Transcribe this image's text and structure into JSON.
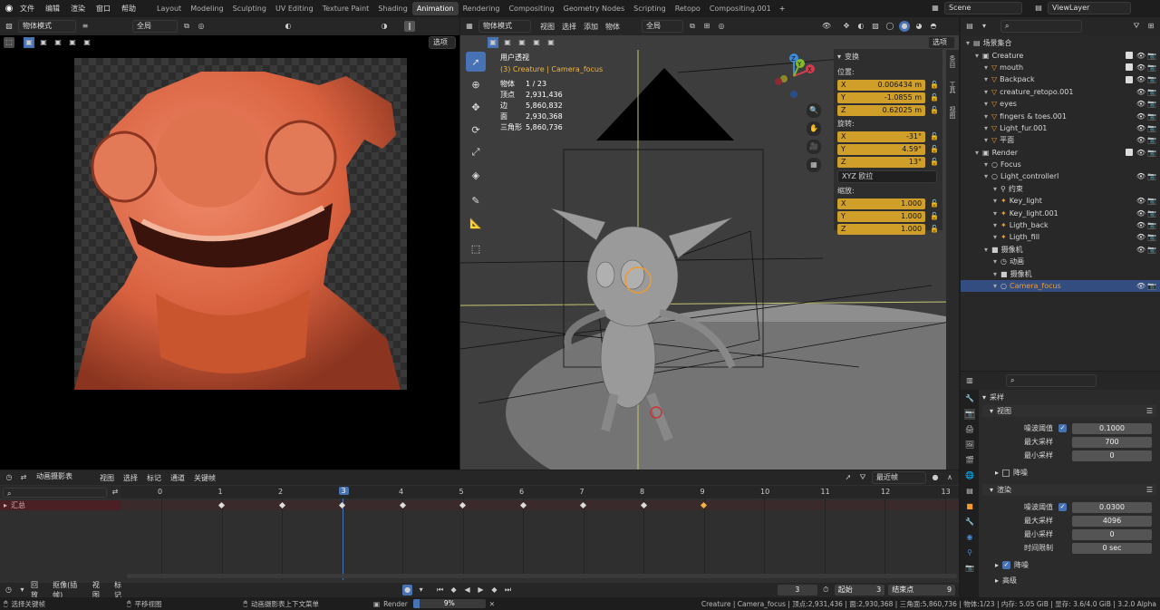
{
  "topbar": {
    "menu": [
      "文件",
      "编辑",
      "渲染",
      "窗口",
      "帮助"
    ],
    "tabs": [
      "Layout",
      "Modeling",
      "Sculpting",
      "UV Editing",
      "Texture Paint",
      "Shading",
      "Animation",
      "Rendering",
      "Compositing",
      "Geometry Nodes",
      "Scripting",
      "Retopo",
      "Compositing.001"
    ],
    "active_tab": "Animation",
    "add_tab": "+",
    "scene": "Scene",
    "view_layer": "ViewLayer"
  },
  "left_header": {
    "mode": "物体模式",
    "view": "全局",
    "options": "选项"
  },
  "viewport": {
    "mode": "物体模式",
    "menus": [
      "视图",
      "选择",
      "添加",
      "物体"
    ],
    "transform": "全局",
    "options": "选项",
    "view_name": "用户透视",
    "collection_label": "(3) Creature | Camera_focus",
    "stats": [
      {
        "k": "物体",
        "v": "1 / 23"
      },
      {
        "k": "顶点",
        "v": "2,931,436"
      },
      {
        "k": "边",
        "v": "5,860,832"
      },
      {
        "k": "面",
        "v": "2,930,368"
      },
      {
        "k": "三角形",
        "v": "5,860,736"
      }
    ],
    "gizmo": {
      "x": "X",
      "y": "Y",
      "z": "Z"
    }
  },
  "npanel": {
    "title": "变换",
    "location_label": "位置:",
    "location": [
      {
        "a": "X",
        "v": "0.006434 m"
      },
      {
        "a": "Y",
        "v": "-1.0855 m"
      },
      {
        "a": "Z",
        "v": "0.62025 m"
      }
    ],
    "rotation_label": "旋转:",
    "rotation": [
      {
        "a": "X",
        "v": "-31°"
      },
      {
        "a": "Y",
        "v": "4.59°"
      },
      {
        "a": "Z",
        "v": "13°"
      }
    ],
    "rotation_mode": "XYZ 欧拉",
    "scale_label": "缩放:",
    "scale": [
      {
        "a": "X",
        "v": "1.000"
      },
      {
        "a": "Y",
        "v": "1.000"
      },
      {
        "a": "Z",
        "v": "1.000"
      }
    ],
    "side_tabs": [
      "条目",
      "工具",
      "视图"
    ]
  },
  "outliner": {
    "rows": [
      {
        "name": "场景集合",
        "indent": 0,
        "icon": "▤",
        "cb": false,
        "eye": false,
        "cam": false
      },
      {
        "name": "Creature",
        "indent": 1,
        "icon": "▣",
        "cb": true,
        "eye": true,
        "cam": true
      },
      {
        "name": "mouth",
        "indent": 2,
        "icon": "▽",
        "cb": true,
        "eye": true,
        "cam": true
      },
      {
        "name": "Backpack",
        "indent": 2,
        "icon": "▽",
        "cb": true,
        "eye": true,
        "cam": true
      },
      {
        "name": "creature_retopo.001",
        "indent": 2,
        "icon": "▽",
        "cb": false,
        "eye": true,
        "cam": true
      },
      {
        "name": "eyes",
        "indent": 2,
        "icon": "▽",
        "cb": false,
        "eye": true,
        "cam": true
      },
      {
        "name": "fingers & toes.001",
        "indent": 2,
        "icon": "▽",
        "cb": false,
        "eye": true,
        "cam": true
      },
      {
        "name": "Light_fur.001",
        "indent": 2,
        "icon": "▽",
        "cb": false,
        "eye": true,
        "cam": true
      },
      {
        "name": "平面",
        "indent": 2,
        "icon": "▽",
        "cb": false,
        "eye": true,
        "cam": true
      },
      {
        "name": "Render",
        "indent": 1,
        "icon": "▣",
        "cb": true,
        "eye": true,
        "cam": true
      },
      {
        "name": "Focus",
        "indent": 2,
        "icon": "○",
        "cb": false,
        "eye": false,
        "cam": false
      },
      {
        "name": "Light_controllerl",
        "indent": 2,
        "icon": "○",
        "cb": false,
        "eye": true,
        "cam": true
      },
      {
        "name": "约束",
        "indent": 3,
        "icon": "⚲",
        "cb": false,
        "eye": false,
        "cam": false
      },
      {
        "name": "Key_light",
        "indent": 3,
        "icon": "✦",
        "cb": false,
        "eye": true,
        "cam": true
      },
      {
        "name": "Key_light.001",
        "indent": 3,
        "icon": "✦",
        "cb": false,
        "eye": true,
        "cam": true
      },
      {
        "name": "Ligth_back",
        "indent": 3,
        "icon": "✦",
        "cb": false,
        "eye": true,
        "cam": true
      },
      {
        "name": "Ligth_fill",
        "indent": 3,
        "icon": "✦",
        "cb": false,
        "eye": true,
        "cam": true
      },
      {
        "name": "摄像机",
        "indent": 2,
        "icon": "■",
        "cb": false,
        "eye": true,
        "cam": true
      },
      {
        "name": "动画",
        "indent": 3,
        "icon": "◷",
        "cb": false,
        "eye": false,
        "cam": false
      },
      {
        "name": "摄像机",
        "indent": 3,
        "icon": "■",
        "cb": false,
        "eye": false,
        "cam": false
      },
      {
        "name": "Camera_focus",
        "indent": 3,
        "icon": "○",
        "cb": false,
        "eye": true,
        "cam": true,
        "selected": true
      }
    ]
  },
  "properties": {
    "sampling": "采样",
    "viewport": "视图",
    "noise_threshold_label": "噪波阈值",
    "vp_noise_threshold": "0.1000",
    "max_samples_label": "最大采样",
    "vp_max_samples": "700",
    "min_samples_label": "最小采样",
    "vp_min_samples": "0",
    "denoise": "降噪",
    "render": "渲染",
    "r_noise_threshold": "0.0300",
    "r_max_samples": "4096",
    "r_min_samples": "0",
    "time_limit_label": "时间限制",
    "r_time_limit": "0 sec",
    "denoise2": "降噪",
    "advanced": "高级"
  },
  "dopesheet": {
    "mode": "动画摄影表",
    "menus": [
      "视图",
      "选择",
      "标记",
      "通道",
      "关键帧"
    ],
    "snap": "最近帧",
    "summary": "汇总",
    "frames": [
      "0",
      "1",
      "2",
      "3",
      "4",
      "5",
      "6",
      "7",
      "8",
      "9",
      "10",
      "11",
      "12",
      "13"
    ],
    "current_frame": "3",
    "keyframes": [
      1,
      2,
      3,
      4,
      5,
      6,
      7,
      8,
      9
    ]
  },
  "timeline": {
    "menus": [
      "回放",
      "抠像(插帧)",
      "视图",
      "标记"
    ],
    "frame": "3",
    "start_label": "起始",
    "start": "3",
    "end_label": "结束点",
    "end": "9"
  },
  "status": {
    "left1": "选择关键帧",
    "left2": "平移视图",
    "left3": "动画摄影表上下文菜单",
    "render_label": "Render",
    "render_progress": 0.09,
    "render_pct": "9%",
    "right": "Creature | Camera_focus | 顶点:2,931,436 | 面:2,930,368 | 三角面:5,860,736 | 物体:1/23 | 内存: 5.05 GiB | 显存: 3.6/4.0 GiB | 3.2.0 Alpha"
  }
}
